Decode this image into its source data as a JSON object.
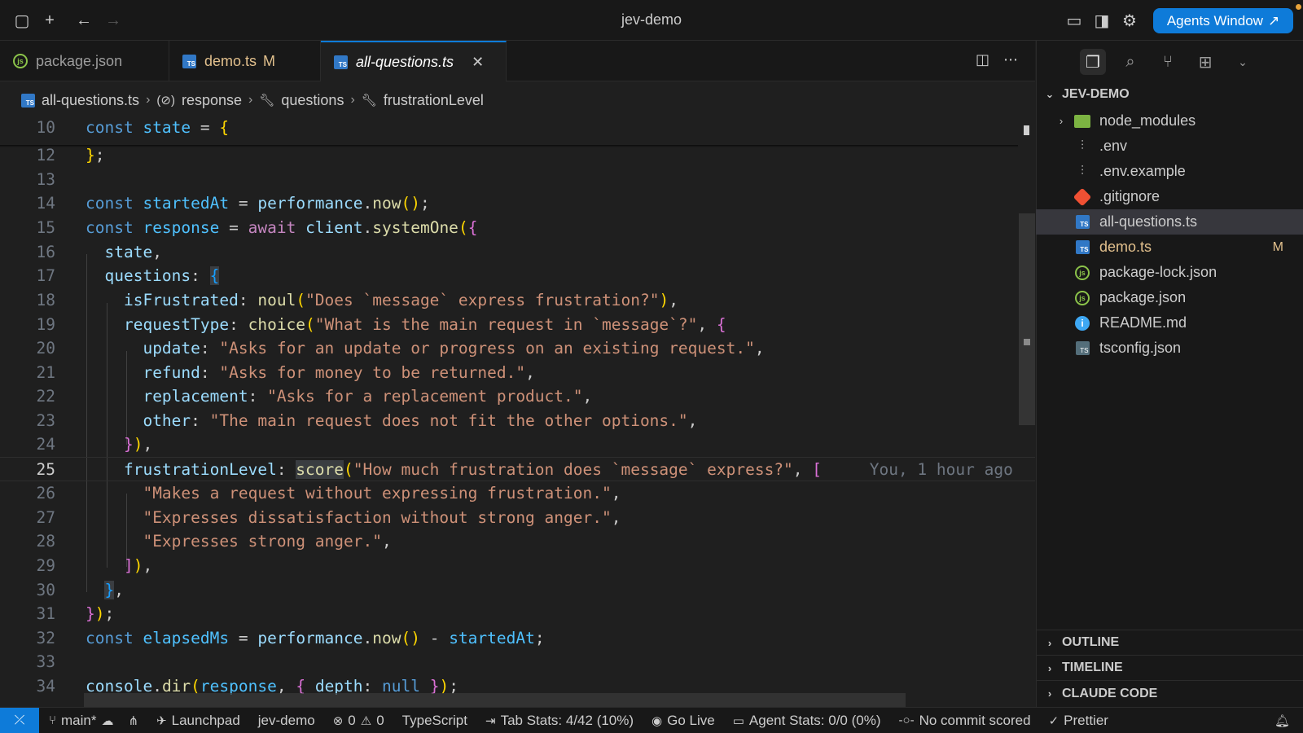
{
  "window": {
    "title": "jev-demo",
    "agents_button": "Agents Window",
    "agents_button_arrow": "↗"
  },
  "tabs": [
    {
      "label": "package.json",
      "modified": ""
    },
    {
      "label": "demo.ts",
      "modified": "M"
    },
    {
      "label": "all-questions.ts",
      "modified": ""
    }
  ],
  "breadcrumb": {
    "file": "all-questions.ts",
    "items": [
      "response",
      "questions",
      "frustrationLevel"
    ],
    "separator": "›"
  },
  "editor": {
    "lines": [
      {
        "n": "10",
        "html": "<span class='k'>const</span> <span class='v'>state</span> = <span class='c1'>{</span>"
      },
      {
        "n": "12",
        "html": "<span class='c1'>}</span>;"
      },
      {
        "n": "13",
        "html": ""
      },
      {
        "n": "14",
        "html": "<span class='k'>const</span> <span class='v'>startedAt</span> = <span class='p'>performance</span>.<span class='f'>now</span><span class='c1'>()</span>;"
      },
      {
        "n": "15",
        "html": "<span class='k'>const</span> <span class='v'>response</span> = <span class='kw2'>await</span> <span class='p'>client</span>.<span class='f'>systemOne</span><span class='c1'>(</span><span class='c2'>{</span>"
      },
      {
        "n": "16",
        "html": "  <span class='p'>state</span>,"
      },
      {
        "n": "17",
        "html": "  <span class='p'>questions</span>: <span class='c3 hl'>{</span>"
      },
      {
        "n": "18",
        "html": "    <span class='p'>isFrustrated</span>: <span class='f'>noul</span><span class='c1'>(</span><span class='s'>\"Does `message` express frustration?\"</span><span class='c1'>)</span>,"
      },
      {
        "n": "19",
        "html": "    <span class='p'>requestType</span>: <span class='f'>choice</span><span class='c1'>(</span><span class='s'>\"What is the main request in `message`?\"</span>, <span class='c2'>{</span>"
      },
      {
        "n": "20",
        "html": "      <span class='p'>update</span>: <span class='s'>\"Asks for an update or progress on an existing request.\"</span>,"
      },
      {
        "n": "21",
        "html": "      <span class='p'>refund</span>: <span class='s'>\"Asks for money to be returned.\"</span>,"
      },
      {
        "n": "22",
        "html": "      <span class='p'>replacement</span>: <span class='s'>\"Asks for a replacement product.\"</span>,"
      },
      {
        "n": "23",
        "html": "      <span class='p'>other</span>: <span class='s'>\"The main request does not fit the other options.\"</span>,"
      },
      {
        "n": "24",
        "html": "    <span class='c2'>}</span><span class='c1'>)</span>,"
      },
      {
        "n": "25",
        "html": "    <span class='p'>frustrationLevel</span>: <span class='f hl'>score</span><span class='c1'>(</span><span class='s'>\"How much frustration does `message` express?\"</span>, <span class='c2'>[</span>     <span class='ghost'>You, 1 hour ago</span>"
      },
      {
        "n": "26",
        "html": "      <span class='s'>\"Makes a request without expressing frustration.\"</span>,"
      },
      {
        "n": "27",
        "html": "      <span class='s'>\"Expresses dissatisfaction without strong anger.\"</span>,"
      },
      {
        "n": "28",
        "html": "      <span class='s'>\"Expresses strong anger.\"</span>,"
      },
      {
        "n": "29",
        "html": "    <span class='c2'>]</span><span class='c1'>)</span>,"
      },
      {
        "n": "30",
        "html": "  <span class='c3 hl'>}</span>,"
      },
      {
        "n": "31",
        "html": "<span class='c2'>}</span><span class='c1'>)</span>;"
      },
      {
        "n": "32",
        "html": "<span class='k'>const</span> <span class='v'>elapsedMs</span> = <span class='p'>performance</span>.<span class='f'>now</span><span class='c1'>()</span> - <span class='v'>startedAt</span>;"
      },
      {
        "n": "33",
        "html": ""
      },
      {
        "n": "34",
        "html": "<span class='p'>console</span>.<span class='f'>dir</span><span class='c1'>(</span><span class='v'>response</span>, <span class='c2'>{</span> <span class='p'>depth</span>: <span class='k'>null</span> <span class='c2'>}</span><span class='c1'>)</span>;"
      }
    ],
    "current_line": "25"
  },
  "explorer": {
    "root": "JEV-DEMO",
    "items": [
      {
        "label": "node_modules",
        "type": "folder",
        "badge": ""
      },
      {
        "label": ".env",
        "type": "env",
        "badge": ""
      },
      {
        "label": ".env.example",
        "type": "env",
        "badge": ""
      },
      {
        "label": ".gitignore",
        "type": "git",
        "badge": ""
      },
      {
        "label": "all-questions.ts",
        "type": "ts",
        "badge": ""
      },
      {
        "label": "demo.ts",
        "type": "ts",
        "badge": "M"
      },
      {
        "label": "package-lock.json",
        "type": "json",
        "badge": ""
      },
      {
        "label": "package.json",
        "type": "json",
        "badge": ""
      },
      {
        "label": "README.md",
        "type": "info",
        "badge": ""
      },
      {
        "label": "tsconfig.json",
        "type": "tsconfig",
        "badge": ""
      }
    ],
    "sections": [
      "OUTLINE",
      "TIMELINE",
      "CLAUDE CODE"
    ]
  },
  "statusbar": {
    "branch": "main*",
    "launchpad": "Launchpad",
    "project": "jev-demo",
    "errors": "0",
    "warnings": "0",
    "language": "TypeScript",
    "tab_stats": "Tab Stats: 4/42 (10%)",
    "go_live": "Go Live",
    "agent_stats": "Agent Stats: 0/0 (0%)",
    "commit": "No commit scored",
    "prettier": "Prettier"
  },
  "colors": {
    "accent": "#0e7bd9",
    "modified": "#e2c08d",
    "editor_bg": "#1f1f1f",
    "sidebar_bg": "#181818"
  }
}
